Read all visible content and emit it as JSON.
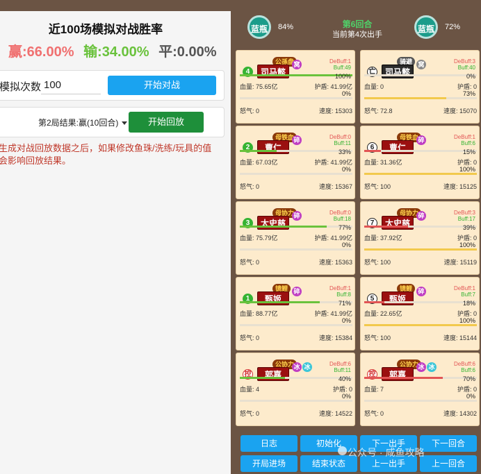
{
  "left": {
    "title": "近100场模拟对战胜率",
    "win_label": "赢:66.00%",
    "lose_label": "输:34.00%",
    "draw_label": "平:0.00%",
    "sim_label": "模拟次数",
    "sim_value": "100",
    "start_battle": "开始对战",
    "result_select": "第2局结果:赢(10回合)",
    "start_replay": "开始回放",
    "note": "生成对战回放数据之后，如果修改鱼珠/洗练/玩具的值会影响回放结果。"
  },
  "header": {
    "left_coin": "蓝瓶",
    "left_pct": "84%",
    "right_coin": "蓝瓶",
    "right_pct": "72%",
    "round": "第6回合",
    "current": "当前第4次出手"
  },
  "labels": {
    "hp": "血量:",
    "shield": "护盾:",
    "rage": "怒气:",
    "speed": "速度:"
  },
  "cards": [
    {
      "num": "4",
      "numStyle": "green",
      "name": "司马懿",
      "tag": "公孫盘",
      "tagStyle": "normal",
      "circles": [
        {
          "t": "窝",
          "c": "purple"
        }
      ],
      "debuff": "DeBuff:1",
      "buff": "Buff:49",
      "hp_pct": "100%",
      "hp_fill": 1.0,
      "hp_color": "#6ac23c",
      "hp": "75.65亿",
      "shield": "41.99亿",
      "sh_pct": "0%",
      "sh_fill": 0.0,
      "rage": "0",
      "speed": "15303",
      "plate": "red"
    },
    {
      "num": "亡",
      "numStyle": "dark",
      "name": "司马懿",
      "tag": "骑避",
      "tagStyle": "gray",
      "circles": [
        {
          "t": "窝",
          "c": "grey"
        }
      ],
      "debuff": "DeBuff:3",
      "buff": "Buff:40",
      "hp_pct": "0%",
      "hp_fill": 0.0,
      "hp_color": "#e25555",
      "hp": "0",
      "shield": "0",
      "sh_pct": "73%",
      "sh_fill": 0.73,
      "rage": "72.8",
      "speed": "15070",
      "plate": "dark"
    },
    {
      "num": "2",
      "numStyle": "green",
      "name": "曹仁",
      "tag": "母铁血",
      "tagStyle": "normal",
      "circles": [
        {
          "t": "碎",
          "c": "purple"
        }
      ],
      "debuff": "DeBuff:0",
      "buff": "Buff:11",
      "hp_pct": "33%",
      "hp_fill": 0.33,
      "hp_color": "#6ac23c",
      "hp": "67.03亿",
      "shield": "41.99亿",
      "sh_pct": "0%",
      "sh_fill": 0.0,
      "rage": "0",
      "speed": "15367",
      "plate": "red"
    },
    {
      "num": "6",
      "numStyle": "dark",
      "name": "曹仁",
      "tag": "母铁血",
      "tagStyle": "normal",
      "circles": [
        {
          "t": "碎",
          "c": "purple"
        }
      ],
      "debuff": "DeBuff:1",
      "buff": "Buff:6",
      "hp_pct": "15%",
      "hp_fill": 0.15,
      "hp_color": "#e25555",
      "hp": "31.36亿",
      "shield": "0",
      "sh_pct": "100%",
      "sh_fill": 1.0,
      "rage": "100",
      "speed": "15125",
      "plate": "red"
    },
    {
      "num": "3",
      "numStyle": "green",
      "name": "太史慈",
      "tag": "母协力",
      "tagStyle": "normal",
      "circles": [
        {
          "t": "碎",
          "c": "purple"
        }
      ],
      "debuff": "DeBuff:0",
      "buff": "Buff:18",
      "hp_pct": "77%",
      "hp_fill": 0.77,
      "hp_color": "#6ac23c",
      "hp": "75.79亿",
      "shield": "41.99亿",
      "sh_pct": "0%",
      "sh_fill": 0.0,
      "rage": "0",
      "speed": "15363",
      "plate": "red"
    },
    {
      "num": "7",
      "numStyle": "dark",
      "name": "太史慈",
      "tag": "母协力",
      "tagStyle": "normal",
      "circles": [
        {
          "t": "碎",
          "c": "purple"
        }
      ],
      "debuff": "DeBuff:3",
      "buff": "Buff:17",
      "hp_pct": "39%",
      "hp_fill": 0.39,
      "hp_color": "#e25555",
      "hp": "37.92亿",
      "shield": "0",
      "sh_pct": "100%",
      "sh_fill": 1.0,
      "rage": "100",
      "speed": "15119",
      "plate": "red"
    },
    {
      "num": "1",
      "numStyle": "green",
      "name": "甄姬",
      "tag": "镜鲤",
      "tagStyle": "normal",
      "circles": [
        {
          "t": "碎",
          "c": "purple"
        }
      ],
      "debuff": "DeBuff:1",
      "buff": "Buff:8",
      "hp_pct": "71%",
      "hp_fill": 0.71,
      "hp_color": "#6ac23c",
      "hp": "88.77亿",
      "shield": "41.99亿",
      "sh_pct": "0%",
      "sh_fill": 0.0,
      "rage": "0",
      "speed": "15384",
      "plate": "red"
    },
    {
      "num": "5",
      "numStyle": "dark",
      "name": "甄姬",
      "tag": "镜鲤",
      "tagStyle": "normal",
      "circles": [
        {
          "t": "碎",
          "c": "purple"
        }
      ],
      "debuff": "DeBuff:1",
      "buff": "Buff:7",
      "hp_pct": "18%",
      "hp_fill": 0.18,
      "hp_color": "#e25555",
      "hp": "22.65亿",
      "shield": "0",
      "sh_pct": "100%",
      "sh_fill": 1.0,
      "rage": "100",
      "speed": "15144",
      "plate": "red"
    },
    {
      "num": "控",
      "numStyle": "red",
      "name": "郭嘉",
      "tag": "公协力",
      "tagStyle": "normal",
      "circles": [
        {
          "t": "冰",
          "c": "purple"
        },
        {
          "t": "冰",
          "c": "cyan"
        }
      ],
      "debuff": "DeBuff:6",
      "buff": "Buff:11",
      "hp_pct": "40%",
      "hp_fill": 0.4,
      "hp_color": "#6ac23c",
      "hp": "4",
      "shield": "0",
      "sh_pct": "0%",
      "sh_fill": 0.0,
      "rage": "0",
      "speed": "14522",
      "plate": "red"
    },
    {
      "num": "控",
      "numStyle": "red",
      "name": "郭嘉",
      "tag": "公协力",
      "tagStyle": "normal",
      "circles": [
        {
          "t": "冰",
          "c": "purple"
        },
        {
          "t": "冰",
          "c": "cyan"
        }
      ],
      "debuff": "DeBuff:6",
      "buff": "Buff:6",
      "hp_pct": "70%",
      "hp_fill": 0.7,
      "hp_color": "#e25555",
      "hp": "7",
      "shield": "0",
      "sh_pct": "0%",
      "sh_fill": 0.0,
      "rage": "0",
      "speed": "14302",
      "plate": "red"
    }
  ],
  "buttons": {
    "log": "日志",
    "init": "初始化",
    "next_action": "下一出手",
    "next_round": "下一回合",
    "open_enter": "开局进场",
    "end_state": "结束状态",
    "prev_action": "上一出手",
    "prev_round": "上一回合"
  },
  "watermark": "公众号 · 咸鱼攻略"
}
